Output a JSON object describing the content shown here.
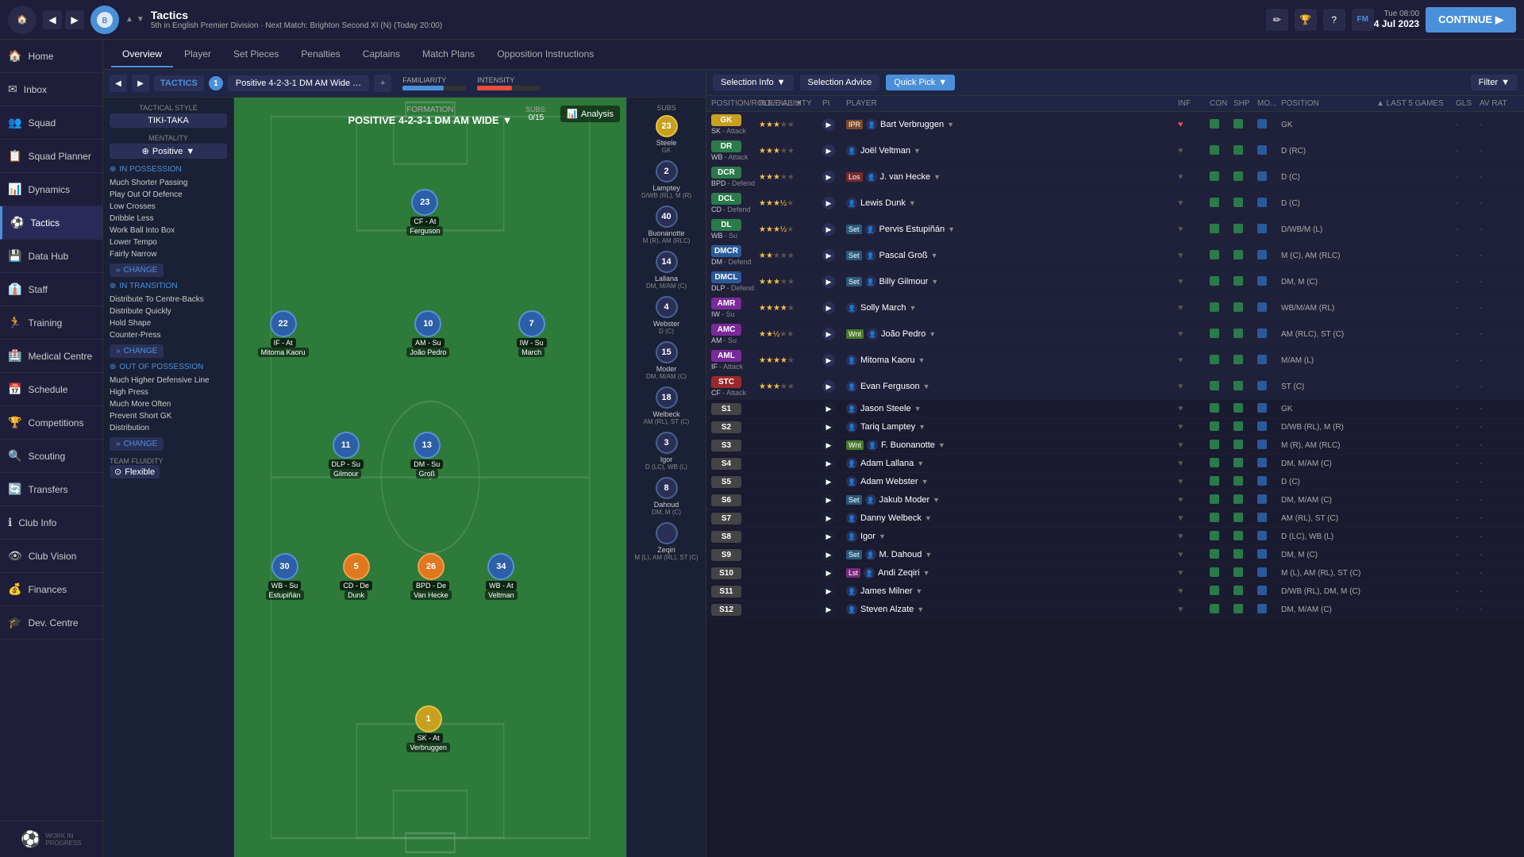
{
  "topbar": {
    "title": "Tactics",
    "subtitle": "5th in English Premier Division · Next Match: Brighton Second XI (N) (Today 20:00)",
    "day": "Tue 08:00",
    "date": "4 Jul 2023",
    "continue_label": "CONTINUE"
  },
  "sidebar": {
    "items": [
      {
        "id": "home",
        "label": "Home",
        "icon": "🏠"
      },
      {
        "id": "inbox",
        "label": "Inbox",
        "icon": "✉"
      },
      {
        "id": "squad",
        "label": "Squad",
        "icon": "👥"
      },
      {
        "id": "squad-planner",
        "label": "Squad Planner",
        "icon": "📋"
      },
      {
        "id": "dynamics",
        "label": "Dynamics",
        "icon": "📊"
      },
      {
        "id": "tactics",
        "label": "Tactics",
        "icon": "⚽",
        "active": true
      },
      {
        "id": "data-hub",
        "label": "Data Hub",
        "icon": "💾"
      },
      {
        "id": "staff",
        "label": "Staff",
        "icon": "👔"
      },
      {
        "id": "training",
        "label": "Training",
        "icon": "🏃"
      },
      {
        "id": "medical",
        "label": "Medical Centre",
        "icon": "🏥"
      },
      {
        "id": "schedule",
        "label": "Schedule",
        "icon": "📅"
      },
      {
        "id": "competitions",
        "label": "Competitions",
        "icon": "🏆"
      },
      {
        "id": "scouting",
        "label": "Scouting",
        "icon": "🔍"
      },
      {
        "id": "transfers",
        "label": "Transfers",
        "icon": "🔄"
      },
      {
        "id": "club-info",
        "label": "Club Info",
        "icon": "ℹ"
      },
      {
        "id": "club-vision",
        "label": "Club Vision",
        "icon": "👁"
      },
      {
        "id": "finances",
        "label": "Finances",
        "icon": "💰"
      },
      {
        "id": "dev-centre",
        "label": "Dev. Centre",
        "icon": "🎓"
      }
    ]
  },
  "tabs": [
    "Overview",
    "Player",
    "Set Pieces",
    "Penalties",
    "Captains",
    "Match Plans",
    "Opposition Instructions"
  ],
  "active_tab": "Overview",
  "tactics": {
    "name": "Positive 4-2-3-1 DM AM Wide …",
    "number": "1",
    "formation": "POSITIVE 4-2-3-1 DM AM WIDE",
    "style": "TIKI-TAKA",
    "mentality": "Positive",
    "familiarity_pct": 65,
    "intensity_pct": 55,
    "subs": "0/15",
    "in_possession": {
      "items": [
        "Much Shorter Passing",
        "Play Out Of Defence",
        "Low Crosses",
        "Dribble Less",
        "Work Ball Into Box",
        "Lower Tempo",
        "Fairly Narrow"
      ]
    },
    "in_transition": {
      "items": [
        "Distribute To Centre-Backs",
        "Distribute Quickly",
        "Hold Shape",
        "Counter-Press"
      ]
    },
    "out_of_possession": {
      "items": [
        "Much Higher Defensive Line",
        "High Press",
        "Much More Often",
        "Prevent Short GK",
        "Distribution"
      ]
    },
    "fluidity": "Flexible"
  },
  "players_on_pitch": [
    {
      "number": "1",
      "role": "SK - At",
      "name": "Verbruggen",
      "x": "47",
      "y": "82",
      "type": "yellow"
    },
    {
      "number": "30",
      "role": "WB - Su",
      "name": "Estupiñán",
      "x": "12",
      "y": "62",
      "type": "blue"
    },
    {
      "number": "5",
      "role": "CD - De",
      "name": "Dunk",
      "x": "30",
      "y": "62",
      "type": "orange"
    },
    {
      "number": "26",
      "role": "BPD - De",
      "name": "Van Hecke",
      "x": "48",
      "y": "62",
      "type": "orange"
    },
    {
      "number": "34",
      "role": "WB - At",
      "name": "Veltman",
      "x": "66",
      "y": "62",
      "type": "blue"
    },
    {
      "number": "11",
      "role": "DLP - Su",
      "name": "Gilmour",
      "x": "28",
      "y": "46",
      "type": "blue"
    },
    {
      "number": "13",
      "role": "DM - Su",
      "name": "Groß",
      "x": "48",
      "y": "46",
      "type": "blue"
    },
    {
      "number": "22",
      "role": "IF - At",
      "name": "Mitoma Kaoru",
      "x": "10",
      "y": "30",
      "type": "blue"
    },
    {
      "number": "10",
      "role": "AM - Su",
      "name": "João Pedro",
      "x": "47",
      "y": "30",
      "type": "blue"
    },
    {
      "number": "7",
      "role": "IW - Su",
      "name": "March",
      "x": "75",
      "y": "30",
      "type": "blue"
    },
    {
      "number": "23",
      "role": "CF - At",
      "name": "Ferguson",
      "x": "47",
      "y": "14",
      "type": "blue"
    }
  ],
  "subs_list": [
    {
      "number": "23",
      "name": "Steele",
      "pos": "GK"
    },
    {
      "number": "2",
      "name": "Lamptey",
      "pos": "D/WB (RL), M (R)"
    },
    {
      "number": "40",
      "name": "Buonanotte",
      "pos": "M (R), AM (RLC)"
    },
    {
      "number": "14",
      "name": "Lallana",
      "pos": "DM, M/AM (C)"
    },
    {
      "number": "4",
      "name": "Webster",
      "pos": "D (C)"
    },
    {
      "number": "15",
      "name": "Moder",
      "pos": "DM, M/AM (C)"
    },
    {
      "number": "18",
      "name": "Welbeck",
      "pos": "AM (RL), ST (C)"
    },
    {
      "number": "3",
      "name": "Igor",
      "pos": "D (LC), WB (L)"
    },
    {
      "number": "8",
      "name": "Dahoud",
      "pos": "DM, M (C)"
    },
    {
      "number": "",
      "name": "Zeqiri",
      "pos": "M (L), AM (RL), ST (C)"
    }
  ],
  "selection_header": {
    "selection_info": "Selection Info",
    "selection_advice": "Selection Advice",
    "quick_pick": "Quick Pick",
    "filter": "Filter"
  },
  "table_headers": {
    "position": "POSITION/ROLE/DU...",
    "role_ability": "ROLE ABILITY",
    "pi": "PI",
    "player": "PLAYER",
    "inf": "INF",
    "con": "CON",
    "shp": "SHP",
    "mor": "MO...",
    "pos": "POSITION",
    "games": "▲ LAST 5 GAMES",
    "gls": "GLS",
    "avrat": "AV RAT"
  },
  "players": [
    {
      "pos": "GK",
      "pos_type": "gk",
      "role": "SK",
      "duty": "Attack",
      "stars": 3,
      "pi": "",
      "tag": "IPR",
      "name": "Bart Verbruggen",
      "inf": true,
      "con": true,
      "shp": true,
      "mor": true,
      "position": "GK",
      "gls": "-",
      "avrat": "-"
    },
    {
      "pos": "DR",
      "pos_type": "dr",
      "role": "WB",
      "duty": "Attack",
      "stars": 3,
      "pi": "",
      "tag": "",
      "name": "Joël Veltman",
      "inf": false,
      "con": true,
      "shp": true,
      "mor": true,
      "position": "D (RC)",
      "gls": "-",
      "avrat": "-"
    },
    {
      "pos": "DCR",
      "pos_type": "dcr",
      "role": "BPD",
      "duty": "Defend",
      "stars": 3,
      "pi": "",
      "tag": "Los",
      "name": "J. van Hecke",
      "inf": false,
      "con": true,
      "shp": true,
      "mor": true,
      "position": "D (C)",
      "gls": "-",
      "avrat": "-"
    },
    {
      "pos": "DCL",
      "pos_type": "dcl",
      "role": "CD",
      "duty": "Defend",
      "stars": 3.5,
      "pi": "",
      "tag": "",
      "name": "Lewis Dunk",
      "inf": false,
      "con": true,
      "shp": true,
      "mor": true,
      "position": "D (C)",
      "gls": "-",
      "avrat": "-"
    },
    {
      "pos": "DL",
      "pos_type": "dl",
      "role": "WB",
      "duty": "Su",
      "stars": 3.5,
      "pi": "",
      "tag": "Set",
      "name": "Pervis Estupiñán",
      "inf": false,
      "con": true,
      "shp": true,
      "mor": true,
      "position": "D/WB/M (L)",
      "gls": "-",
      "avrat": "-"
    },
    {
      "pos": "DMCR",
      "pos_type": "dmcr",
      "role": "DM",
      "duty": "Defend",
      "stars": 2,
      "pi": "",
      "tag": "Set",
      "name": "Pascal Groß",
      "inf": false,
      "con": true,
      "shp": true,
      "mor": true,
      "position": "M (C), AM (RLC)",
      "gls": "-",
      "avrat": "-"
    },
    {
      "pos": "DMCL",
      "pos_type": "dmcl",
      "role": "DLP",
      "duty": "Defend",
      "stars": 3,
      "pi": "",
      "tag": "Set",
      "name": "Billy Gilmour",
      "inf": false,
      "con": true,
      "shp": true,
      "mor": true,
      "position": "DM, M (C)",
      "gls": "-",
      "avrat": "-"
    },
    {
      "pos": "AMR",
      "pos_type": "amr",
      "role": "IW",
      "duty": "Su",
      "stars": 4,
      "pi": "",
      "tag": "",
      "name": "Solly March",
      "inf": false,
      "con": true,
      "shp": true,
      "mor": true,
      "position": "WB/M/AM (RL)",
      "gls": "-",
      "avrat": "-"
    },
    {
      "pos": "AMC",
      "pos_type": "amc",
      "role": "AM",
      "duty": "Su",
      "stars": 2.5,
      "pi": "",
      "tag": "Wnt",
      "name": "João Pedro",
      "inf": false,
      "con": true,
      "shp": true,
      "mor": true,
      "position": "AM (RLC), ST (C)",
      "gls": "-",
      "avrat": "-"
    },
    {
      "pos": "AML",
      "pos_type": "aml",
      "role": "IF",
      "duty": "Attack",
      "stars": 4,
      "pi": "",
      "tag": "",
      "name": "Mitoma Kaoru",
      "inf": false,
      "con": true,
      "shp": true,
      "mor": true,
      "position": "M/AM (L)",
      "gls": "-",
      "avrat": "-"
    },
    {
      "pos": "STC",
      "pos_type": "stc",
      "role": "CF",
      "duty": "Attack",
      "stars": 3,
      "pi": "",
      "tag": "",
      "name": "Evan Ferguson",
      "inf": false,
      "con": true,
      "shp": true,
      "mor": true,
      "position": "ST (C)",
      "gls": "-",
      "avrat": "-"
    },
    {
      "pos": "S1",
      "pos_type": "s",
      "role": "",
      "duty": "",
      "stars": 0,
      "pi": "",
      "tag": "",
      "name": "Jason Steele",
      "inf": false,
      "con": true,
      "shp": true,
      "mor": true,
      "position": "GK",
      "gls": "-",
      "avrat": "-"
    },
    {
      "pos": "S2",
      "pos_type": "s",
      "role": "",
      "duty": "",
      "stars": 0,
      "pi": "",
      "tag": "",
      "name": "Tariq Lamptey",
      "inf": false,
      "con": true,
      "shp": true,
      "mor": true,
      "position": "D/WB (RL), M (R)",
      "gls": "-",
      "avrat": "-"
    },
    {
      "pos": "S3",
      "pos_type": "s",
      "role": "",
      "duty": "",
      "stars": 0,
      "pi": "",
      "tag": "Wnt",
      "name": "F. Buonanotte",
      "inf": false,
      "con": true,
      "shp": true,
      "mor": true,
      "position": "M (R), AM (RLC)",
      "gls": "-",
      "avrat": "-"
    },
    {
      "pos": "S4",
      "pos_type": "s",
      "role": "",
      "duty": "",
      "stars": 0,
      "pi": "",
      "tag": "",
      "name": "Adam Lallana",
      "inf": false,
      "con": true,
      "shp": true,
      "mor": true,
      "position": "DM, M/AM (C)",
      "gls": "-",
      "avrat": "-"
    },
    {
      "pos": "S5",
      "pos_type": "s",
      "role": "",
      "duty": "",
      "stars": 0,
      "pi": "",
      "tag": "",
      "name": "Adam Webster",
      "inf": false,
      "con": true,
      "shp": true,
      "mor": true,
      "position": "D (C)",
      "gls": "-",
      "avrat": "-"
    },
    {
      "pos": "S6",
      "pos_type": "s",
      "role": "",
      "duty": "",
      "stars": 0,
      "pi": "",
      "tag": "Set",
      "name": "Jakub Moder",
      "inf": false,
      "con": true,
      "shp": true,
      "mor": true,
      "position": "DM, M/AM (C)",
      "gls": "-",
      "avrat": "-"
    },
    {
      "pos": "S7",
      "pos_type": "s",
      "role": "",
      "duty": "",
      "stars": 0,
      "pi": "",
      "tag": "",
      "name": "Danny Welbeck",
      "inf": false,
      "con": true,
      "shp": true,
      "mor": true,
      "position": "AM (RL), ST (C)",
      "gls": "-",
      "avrat": "-"
    },
    {
      "pos": "S8",
      "pos_type": "s",
      "role": "",
      "duty": "",
      "stars": 0,
      "pi": "",
      "tag": "",
      "name": "Igor",
      "inf": false,
      "con": true,
      "shp": true,
      "mor": true,
      "position": "D (LC), WB (L)",
      "gls": "-",
      "avrat": "-"
    },
    {
      "pos": "S9",
      "pos_type": "s",
      "role": "",
      "duty": "",
      "stars": 0,
      "pi": "",
      "tag": "Set",
      "name": "M. Dahoud",
      "inf": false,
      "con": true,
      "shp": true,
      "mor": true,
      "position": "DM, M (C)",
      "gls": "-",
      "avrat": "-"
    },
    {
      "pos": "S10",
      "pos_type": "s",
      "role": "",
      "duty": "",
      "stars": 0,
      "pi": "",
      "tag": "Lst",
      "name": "Andi Zeqiri",
      "inf": false,
      "con": true,
      "shp": true,
      "mor": true,
      "position": "M (L), AM (RL), ST (C)",
      "gls": "-",
      "avrat": "-"
    },
    {
      "pos": "S11",
      "pos_type": "s",
      "role": "",
      "duty": "",
      "stars": 0,
      "pi": "",
      "tag": "",
      "name": "James Milner",
      "inf": false,
      "con": true,
      "shp": true,
      "mor": true,
      "position": "D/WB (RL), DM, M (C)",
      "gls": "-",
      "avrat": "-"
    },
    {
      "pos": "S12",
      "pos_type": "s",
      "role": "",
      "duty": "",
      "stars": 0,
      "pi": "",
      "tag": "",
      "name": "Steven Alzate",
      "inf": false,
      "con": true,
      "shp": true,
      "mor": true,
      "position": "DM, M/AM (C)",
      "gls": "-",
      "avrat": "-"
    }
  ]
}
